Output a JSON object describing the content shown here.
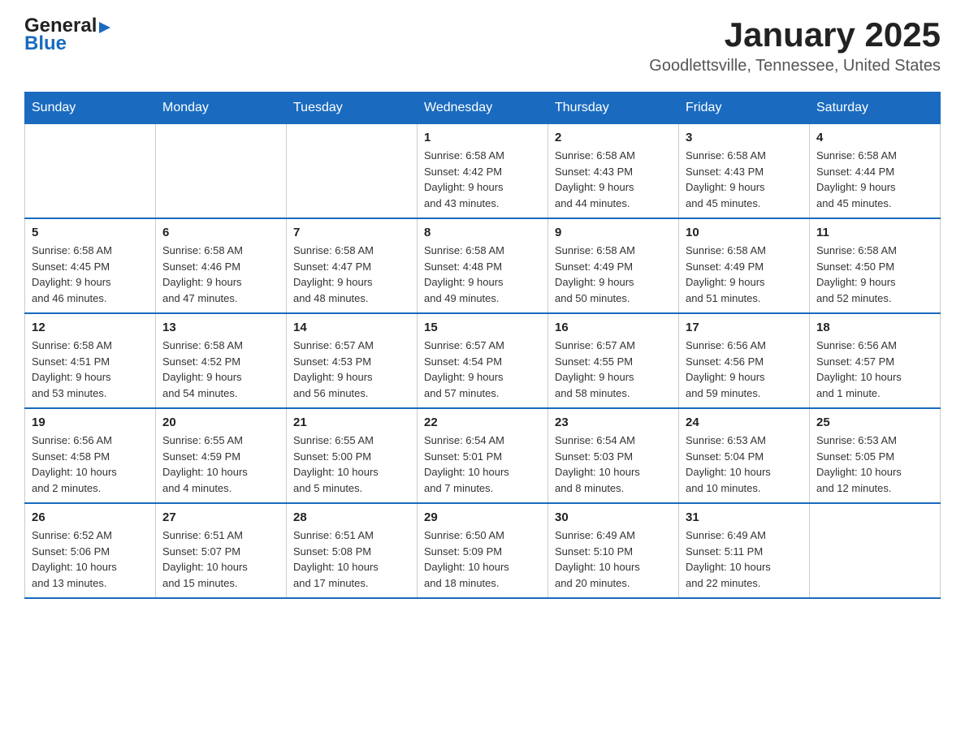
{
  "header": {
    "logo": {
      "text_general": "General",
      "text_blue": "Blue",
      "arrow": "▶"
    },
    "title": "January 2025",
    "subtitle": "Goodlettsville, Tennessee, United States"
  },
  "calendar": {
    "days_of_week": [
      "Sunday",
      "Monday",
      "Tuesday",
      "Wednesday",
      "Thursday",
      "Friday",
      "Saturday"
    ],
    "weeks": [
      {
        "days": [
          {
            "number": "",
            "info": ""
          },
          {
            "number": "",
            "info": ""
          },
          {
            "number": "",
            "info": ""
          },
          {
            "number": "1",
            "info": "Sunrise: 6:58 AM\nSunset: 4:42 PM\nDaylight: 9 hours\nand 43 minutes."
          },
          {
            "number": "2",
            "info": "Sunrise: 6:58 AM\nSunset: 4:43 PM\nDaylight: 9 hours\nand 44 minutes."
          },
          {
            "number": "3",
            "info": "Sunrise: 6:58 AM\nSunset: 4:43 PM\nDaylight: 9 hours\nand 45 minutes."
          },
          {
            "number": "4",
            "info": "Sunrise: 6:58 AM\nSunset: 4:44 PM\nDaylight: 9 hours\nand 45 minutes."
          }
        ]
      },
      {
        "days": [
          {
            "number": "5",
            "info": "Sunrise: 6:58 AM\nSunset: 4:45 PM\nDaylight: 9 hours\nand 46 minutes."
          },
          {
            "number": "6",
            "info": "Sunrise: 6:58 AM\nSunset: 4:46 PM\nDaylight: 9 hours\nand 47 minutes."
          },
          {
            "number": "7",
            "info": "Sunrise: 6:58 AM\nSunset: 4:47 PM\nDaylight: 9 hours\nand 48 minutes."
          },
          {
            "number": "8",
            "info": "Sunrise: 6:58 AM\nSunset: 4:48 PM\nDaylight: 9 hours\nand 49 minutes."
          },
          {
            "number": "9",
            "info": "Sunrise: 6:58 AM\nSunset: 4:49 PM\nDaylight: 9 hours\nand 50 minutes."
          },
          {
            "number": "10",
            "info": "Sunrise: 6:58 AM\nSunset: 4:49 PM\nDaylight: 9 hours\nand 51 minutes."
          },
          {
            "number": "11",
            "info": "Sunrise: 6:58 AM\nSunset: 4:50 PM\nDaylight: 9 hours\nand 52 minutes."
          }
        ]
      },
      {
        "days": [
          {
            "number": "12",
            "info": "Sunrise: 6:58 AM\nSunset: 4:51 PM\nDaylight: 9 hours\nand 53 minutes."
          },
          {
            "number": "13",
            "info": "Sunrise: 6:58 AM\nSunset: 4:52 PM\nDaylight: 9 hours\nand 54 minutes."
          },
          {
            "number": "14",
            "info": "Sunrise: 6:57 AM\nSunset: 4:53 PM\nDaylight: 9 hours\nand 56 minutes."
          },
          {
            "number": "15",
            "info": "Sunrise: 6:57 AM\nSunset: 4:54 PM\nDaylight: 9 hours\nand 57 minutes."
          },
          {
            "number": "16",
            "info": "Sunrise: 6:57 AM\nSunset: 4:55 PM\nDaylight: 9 hours\nand 58 minutes."
          },
          {
            "number": "17",
            "info": "Sunrise: 6:56 AM\nSunset: 4:56 PM\nDaylight: 9 hours\nand 59 minutes."
          },
          {
            "number": "18",
            "info": "Sunrise: 6:56 AM\nSunset: 4:57 PM\nDaylight: 10 hours\nand 1 minute."
          }
        ]
      },
      {
        "days": [
          {
            "number": "19",
            "info": "Sunrise: 6:56 AM\nSunset: 4:58 PM\nDaylight: 10 hours\nand 2 minutes."
          },
          {
            "number": "20",
            "info": "Sunrise: 6:55 AM\nSunset: 4:59 PM\nDaylight: 10 hours\nand 4 minutes."
          },
          {
            "number": "21",
            "info": "Sunrise: 6:55 AM\nSunset: 5:00 PM\nDaylight: 10 hours\nand 5 minutes."
          },
          {
            "number": "22",
            "info": "Sunrise: 6:54 AM\nSunset: 5:01 PM\nDaylight: 10 hours\nand 7 minutes."
          },
          {
            "number": "23",
            "info": "Sunrise: 6:54 AM\nSunset: 5:03 PM\nDaylight: 10 hours\nand 8 minutes."
          },
          {
            "number": "24",
            "info": "Sunrise: 6:53 AM\nSunset: 5:04 PM\nDaylight: 10 hours\nand 10 minutes."
          },
          {
            "number": "25",
            "info": "Sunrise: 6:53 AM\nSunset: 5:05 PM\nDaylight: 10 hours\nand 12 minutes."
          }
        ]
      },
      {
        "days": [
          {
            "number": "26",
            "info": "Sunrise: 6:52 AM\nSunset: 5:06 PM\nDaylight: 10 hours\nand 13 minutes."
          },
          {
            "number": "27",
            "info": "Sunrise: 6:51 AM\nSunset: 5:07 PM\nDaylight: 10 hours\nand 15 minutes."
          },
          {
            "number": "28",
            "info": "Sunrise: 6:51 AM\nSunset: 5:08 PM\nDaylight: 10 hours\nand 17 minutes."
          },
          {
            "number": "29",
            "info": "Sunrise: 6:50 AM\nSunset: 5:09 PM\nDaylight: 10 hours\nand 18 minutes."
          },
          {
            "number": "30",
            "info": "Sunrise: 6:49 AM\nSunset: 5:10 PM\nDaylight: 10 hours\nand 20 minutes."
          },
          {
            "number": "31",
            "info": "Sunrise: 6:49 AM\nSunset: 5:11 PM\nDaylight: 10 hours\nand 22 minutes."
          },
          {
            "number": "",
            "info": ""
          }
        ]
      }
    ]
  }
}
